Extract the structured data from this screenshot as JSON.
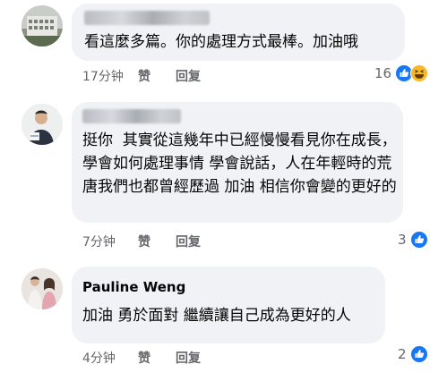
{
  "comments": [
    {
      "name": "",
      "text": "看這麼多篇。你的處理方式最棒。加油哦",
      "time": "17分钟",
      "like": "赞",
      "reply": "回复",
      "reaction_count": "16",
      "reactions": [
        "like-icon",
        "haha-icon"
      ]
    },
    {
      "name": "",
      "text": "挺你  其實從這幾年中已經慢慢看見你在成長，學會如何處理事情 學會說話，人在年輕時的荒唐我們也都曾經歷過 加油 相信你會變的更好的",
      "time": "7分钟",
      "like": "赞",
      "reply": "回复",
      "reaction_count": "3",
      "reactions": [
        "like-icon"
      ]
    },
    {
      "name": "Pauline Weng",
      "text": "加油 勇於面對 繼續讓自己成為更好的人",
      "time": "4分钟",
      "like": "赞",
      "reply": "回复",
      "reaction_count": "2",
      "reactions": [
        "like-icon"
      ]
    }
  ],
  "colors": {
    "bubble": "#f0f2f5",
    "meta": "#65676b",
    "like_blue": "#1877f2",
    "haha_yellow": "#f7b928"
  }
}
